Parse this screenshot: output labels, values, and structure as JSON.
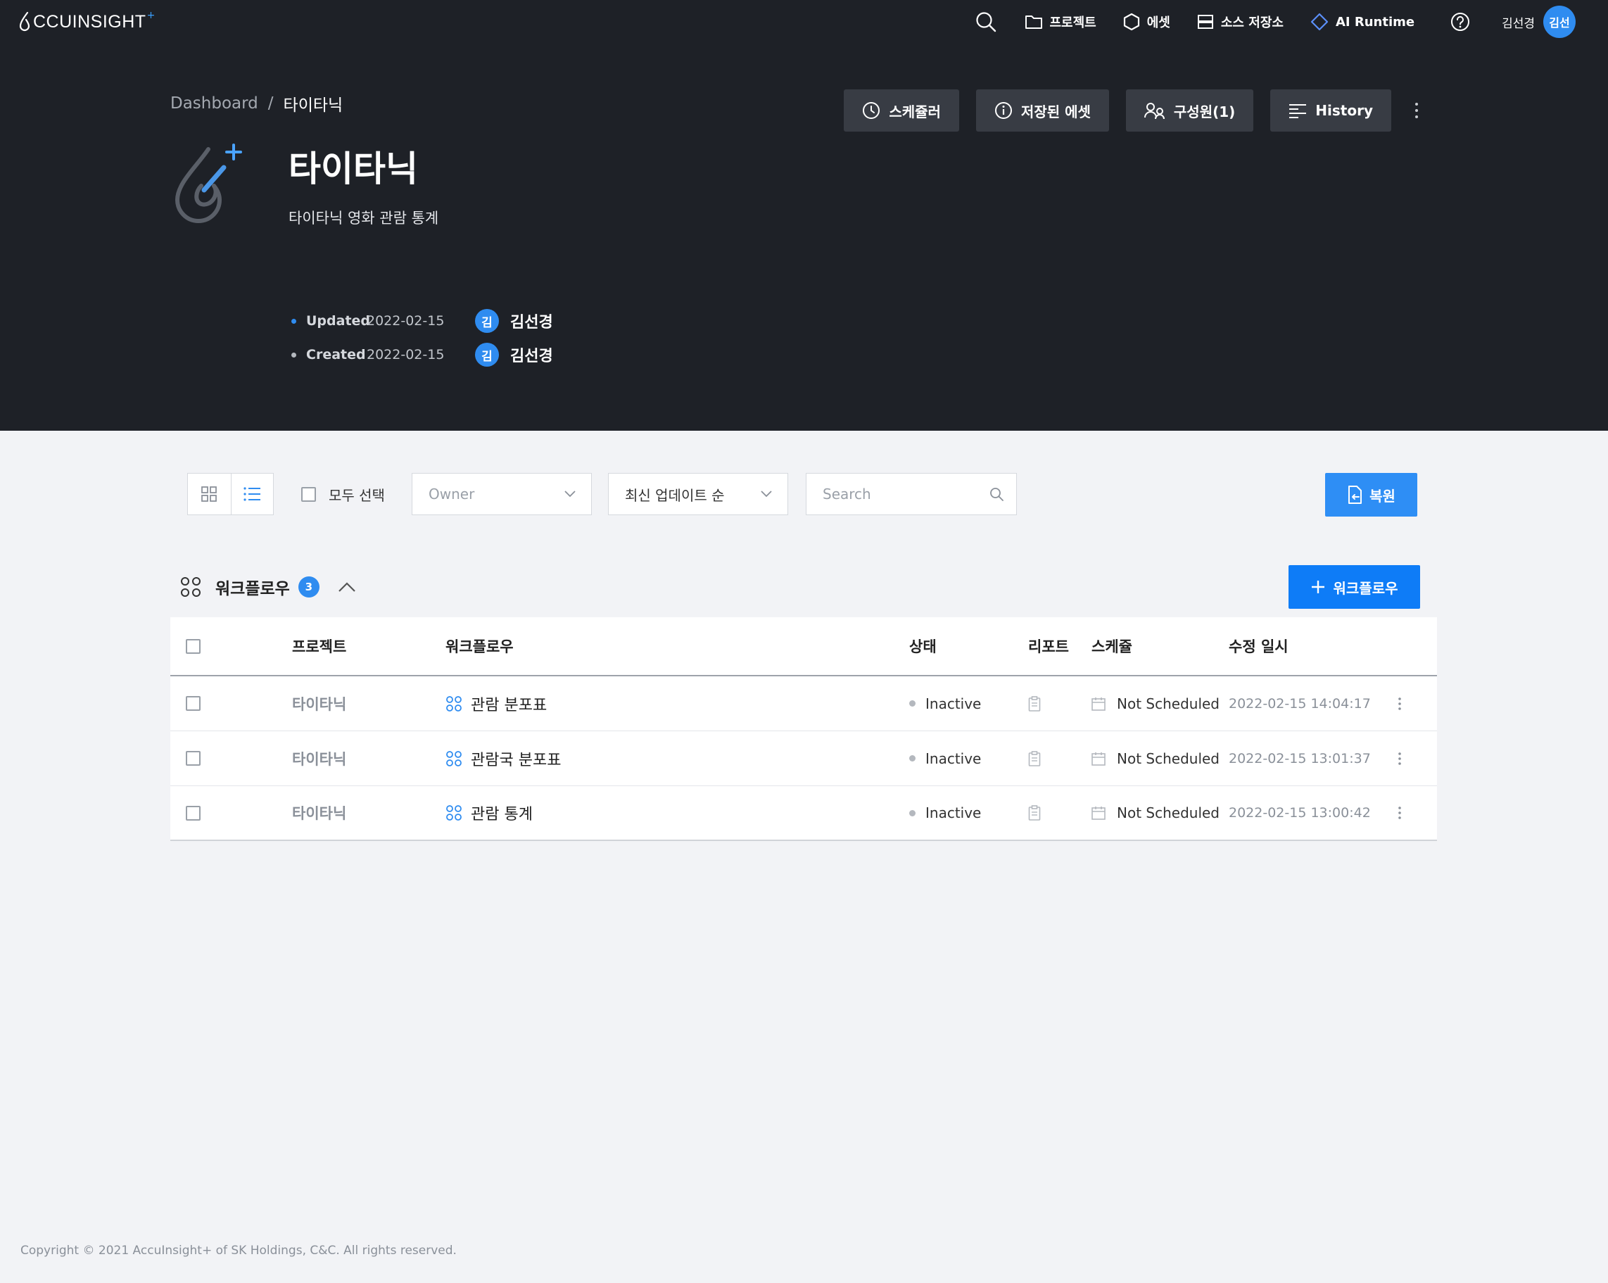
{
  "nav": {
    "logo_text": "CCUINSIGHT",
    "logo_plus": "+",
    "items": [
      {
        "label": "프로젝트",
        "icon": "folder-icon"
      },
      {
        "label": "에셋",
        "icon": "hexagon-icon"
      },
      {
        "label": "소스 저장소",
        "icon": "storage-icon"
      },
      {
        "label": "AI Runtime",
        "icon": "diamond-icon"
      }
    ],
    "user_name": "김선경",
    "user_avatar": "김선"
  },
  "breadcrumb": {
    "root": "Dashboard",
    "separator": "/",
    "current": "타이타닉"
  },
  "actions": {
    "scheduler": "스케쥴러",
    "saved_assets": "저장된 에셋",
    "members": "구성원(1)",
    "history": "History"
  },
  "project": {
    "title": "타이타닉",
    "description": "타이타닉 영화 관람 통계",
    "updated_label": "Updated",
    "updated_date": "2022-02-15",
    "created_label": "Created",
    "created_date": "2022-02-15",
    "updated_by_avatar": "김",
    "updated_by": "김선경",
    "created_by_avatar": "김",
    "created_by": "김선경"
  },
  "toolbar": {
    "select_all": "모두 선택",
    "owner_placeholder": "Owner",
    "sort_value": "최신 업데이트 순",
    "search_placeholder": "Search",
    "restore": "복원"
  },
  "section": {
    "title": "워크플로우",
    "count": "3",
    "add_label": "워크플로우"
  },
  "table": {
    "headers": {
      "project": "프로젝트",
      "workflow": "워크플로우",
      "status": "상태",
      "report": "리포트",
      "schedule": "스케쥴",
      "modified": "수정 일시"
    },
    "rows": [
      {
        "project": "타이타닉",
        "workflow": "관람 분포표",
        "status": "Inactive",
        "schedule": "Not Scheduled",
        "modified": "2022-02-15 14:04:17"
      },
      {
        "project": "타이타닉",
        "workflow": "관람국 분포표",
        "status": "Inactive",
        "schedule": "Not Scheduled",
        "modified": "2022-02-15 13:01:37"
      },
      {
        "project": "타이타닉",
        "workflow": "관람 통계",
        "status": "Inactive",
        "schedule": "Not Scheduled",
        "modified": "2022-02-15 13:00:42"
      }
    ]
  },
  "footer": {
    "copyright": "Copyright © 2021 AccuInsight+ of SK Holdings, C&C. All rights reserved."
  },
  "colors": {
    "accent": "#2f8cf0",
    "dark_bg": "#1e2127",
    "updated_dot": "#2f8cf0",
    "created_dot": "#b4b8be"
  }
}
